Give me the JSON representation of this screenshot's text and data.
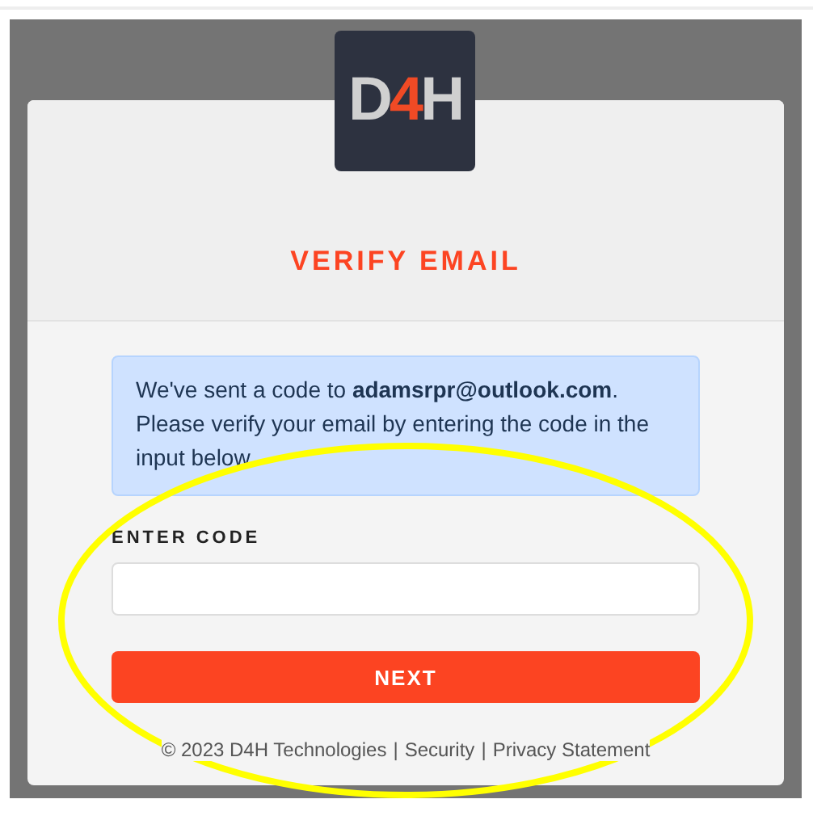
{
  "logo": {
    "parts": [
      {
        "text": "D",
        "accent": false
      },
      {
        "text": "4",
        "accent": true
      },
      {
        "text": "H",
        "accent": false
      }
    ]
  },
  "heading": "VERIFY EMAIL",
  "notice": "We've sent a code to **adamsrpr@outlook.com**. Please verify your email by entering the code in the input below.",
  "code_field": {
    "label": "ENTER CODE"
  },
  "buttons": [
    "NEXT"
  ],
  "footer": {
    "copyright": "© 2023 D4H Technologies",
    "separator": "|",
    "links": [
      "Security",
      "Privacy Statement"
    ]
  },
  "annotation": {
    "kind": "ellipse"
  }
}
